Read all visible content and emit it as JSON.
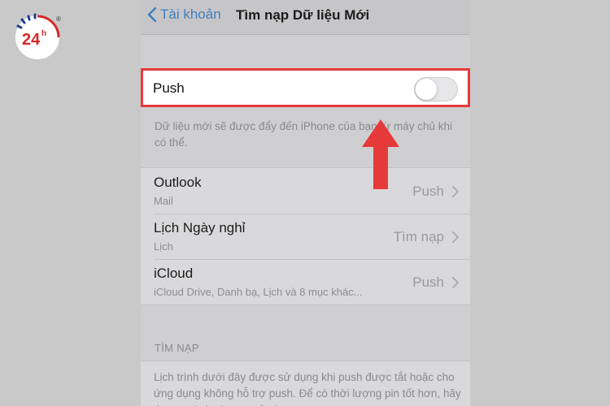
{
  "logo": {
    "text": "24h",
    "mark": "®"
  },
  "navbar": {
    "back_label": "Tài khoản",
    "title": "Tìm nạp Dữ liệu Mới"
  },
  "push": {
    "label": "Push",
    "enabled": false,
    "footnote": "Dữ liệu mới sẽ được đẩy đến iPhone của bạn từ máy chủ khi có thể."
  },
  "accounts": [
    {
      "name": "Outlook",
      "subtitle": "Mail",
      "value": "Push"
    },
    {
      "name": "Lịch Ngày nghỉ",
      "subtitle": "Lịch",
      "value": "Tìm nạp"
    },
    {
      "name": "iCloud",
      "subtitle": "iCloud Drive, Danh bạ, Lịch và 8 mục khác...",
      "value": "Push"
    }
  ],
  "fetch_section": {
    "header": "TÌM NẠP",
    "description": "Lịch trình dưới đây được sử dụng khi push được tắt hoặc cho ứng dụng không hỗ trợ push. Để có thời lượng pin tốt hơn, hãy tìm nạp ít thường xuyên hơn."
  },
  "colors": {
    "highlight": "#e63a3a",
    "link": "#3f7fbf"
  }
}
